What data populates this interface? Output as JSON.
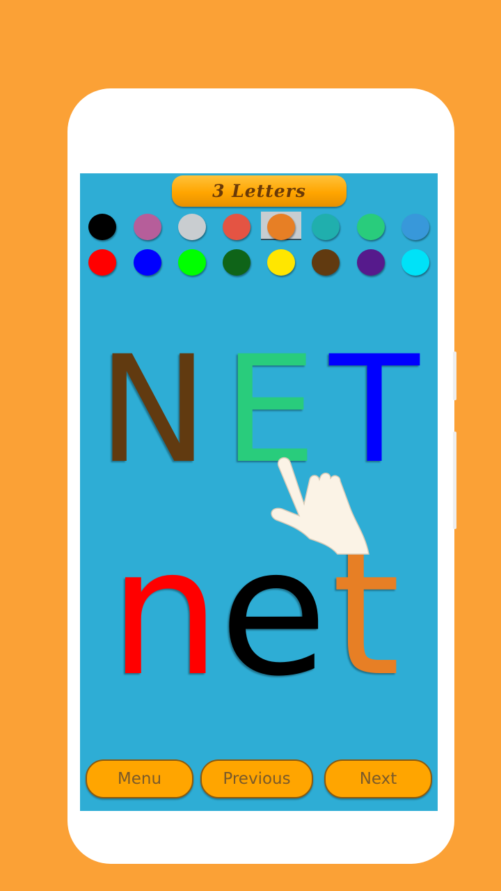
{
  "title": "3 Letters",
  "palette": {
    "selected_index": 4,
    "colors": [
      "#000000",
      "#B65E9A",
      "#C9CDD0",
      "#E45443",
      "#E77F25",
      "#20AFAD",
      "#29CC7C",
      "#3898DA",
      "#FF0000",
      "#0000FF",
      "#00FF00",
      "#0F6418",
      "#FFE600",
      "#613A10",
      "#561A8C",
      "#00E2F8"
    ]
  },
  "uppercase": [
    {
      "char": "N",
      "color": "#613A10"
    },
    {
      "char": "E",
      "color": "#29CC7C"
    },
    {
      "char": "T",
      "color": "#0000FF"
    }
  ],
  "lowercase": [
    {
      "char": "n",
      "color": "#FF0000"
    },
    {
      "char": "e",
      "color": "#000000"
    },
    {
      "char": "t",
      "color": "#E77F25"
    }
  ],
  "buttons": {
    "menu": "Menu",
    "previous": "Previous",
    "next": "Next"
  },
  "colors": {
    "background": "#FBA136",
    "screen": "#2EADD5",
    "button": "#FFA500"
  }
}
